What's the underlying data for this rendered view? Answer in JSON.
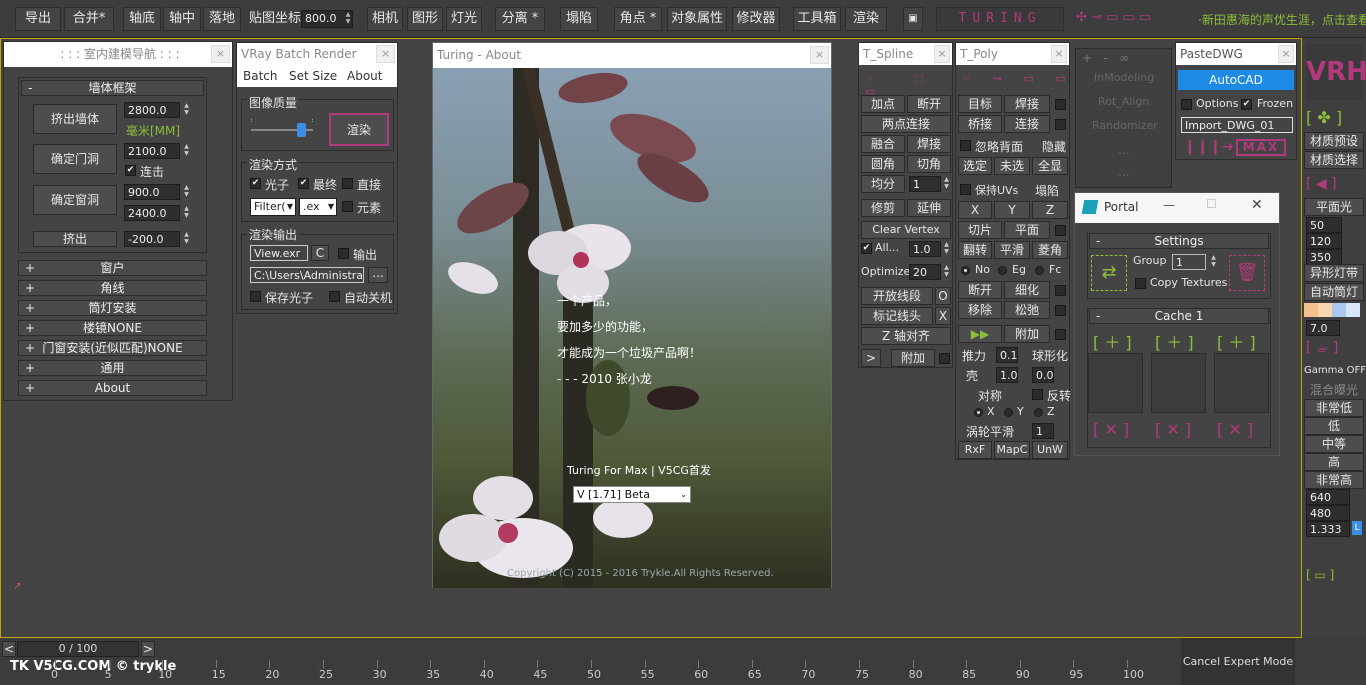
{
  "toolbar": {
    "export": "导出",
    "merge": "合并*",
    "axis_bottom": "轴底",
    "axis_center": "轴中",
    "drop": "落地",
    "map_coord_label": "贴图坐标",
    "map_coord_value": "800.0",
    "camera": "相机",
    "shape": "图形",
    "light": "灯光",
    "detach": "分离 *",
    "collapse": "塌陷",
    "corner": "角点 *",
    "obj_props": "对象属性",
    "modifier": "修改器",
    "toolbox": "工具箱",
    "render": "渲染",
    "turing_logo": "TURING",
    "news": "·新田惠海的声优生涯，点击查看"
  },
  "nav": {
    "title": ": : : 室内建模导航 : : :",
    "wall_section": "墙体框架",
    "extrude_wall": "挤出墙体",
    "wall_height": "2800.0",
    "unit": "毫米[MM]",
    "door": "确定门洞",
    "door_value": "2100.0",
    "continuous": "连击",
    "window": "确定窗洞",
    "window_value1": "900.0",
    "window_value2": "2400.0",
    "extrude": "挤出",
    "extrude_value": "-200.0",
    "rollouts": [
      "窗户",
      "角线",
      "筒灯安装",
      "楼镜NONE",
      "门窗安装(近似匹配)NONE",
      "通用",
      "About"
    ]
  },
  "vray": {
    "title": "VRay Batch Render",
    "menu": [
      "Batch",
      "Set Size",
      "About"
    ],
    "quality": "图像质量",
    "render": "渲染",
    "slider_level": 0.8,
    "method": "渲染方式",
    "photon": "光子",
    "final": "最终",
    "direct": "直接",
    "filter": "Filter(",
    "ext": ".ex",
    "element": "元素",
    "output": "渲染输出",
    "file": "View.exr",
    "c": "C",
    "output_chk": "输出",
    "path": "C:\\Users\\Administrato",
    "browse": "...",
    "save_photon": "保存光子",
    "auto_shutdown": "自动关机"
  },
  "about": {
    "title": "Turing - About",
    "lines": [
      "一个产品，",
      "要加多少的功能，",
      "才能成为一个垃圾产品啊！",
      "- - - 2010 张小龙"
    ],
    "subtitle": "Turing For Max | V5CG首发",
    "version": "V [1.71] Beta",
    "copyright": "Copyright (C) 2015 - 2016 Trykle.All Rights Reserved."
  },
  "spline": {
    "title": "T_Spline",
    "rows": [
      [
        "加点",
        "断开"
      ],
      [
        "两点连接"
      ],
      [
        "融合",
        "焊接"
      ],
      [
        "圆角",
        "切角"
      ]
    ],
    "divide": "均分",
    "divide_value": "1",
    "trim": "修剪",
    "extend": "延伸",
    "clear_vertex": "Clear Vertex",
    "all": "All...",
    "all_value": "1.0",
    "optimize": "Optimize",
    "optimize_value": "20",
    "open_seg": "开放线段",
    "o": "O",
    "mark_head": "标记线头",
    "x": "X",
    "z_align": "Z 轴对齐",
    "arrow": ">",
    "attach": "附加"
  },
  "poly": {
    "title": "T_Poly",
    "target": "目标",
    "weld": "焊接",
    "bridge": "桥接",
    "connect": "连接",
    "ignore_back": "忽略背面",
    "hide": "隐藏",
    "sel": "选定",
    "unsel": "未选",
    "all": "全显",
    "keep_uv": "保持UVs",
    "collapse": "塌陷",
    "x": "X",
    "y": "Y",
    "z": "Z",
    "slice": "切片",
    "plane": "平面",
    "flip": "翻转",
    "smooth": "平滑",
    "diamond": "菱角",
    "no": "No",
    "eg": "Eg",
    "fc": "Fc",
    "break": "断开",
    "refine": "细化",
    "move": "移除",
    "relax": "松弛",
    "attach": "附加",
    "push": "推力",
    "push_value": "0.1",
    "spherify": "球形化",
    "shell": "壳",
    "shell_v1": "1.0",
    "shell_v2": "0.0",
    "symmetry": "对称",
    "mirror": "反转",
    "turbo": "涡轮平滑",
    "turbo_value": "1",
    "rxf": "RxF",
    "mapc": "MapC",
    "unw": "UnW"
  },
  "ghost": {
    "items": [
      "InModeling",
      "Rot_Align",
      "Randomizer",
      "...",
      "..."
    ]
  },
  "pastedwg": {
    "title": "PasteDWG",
    "autocad": "AutoCAD",
    "options": "Options",
    "frozen": "Frozen",
    "layer": "Import_DWG_01",
    "max": "MAX"
  },
  "portal": {
    "title": "Portal",
    "settings": "Settings",
    "group": "Group",
    "group_value": "1",
    "copy_textures": "Copy Textures",
    "cache": "Cache 1"
  },
  "right": {
    "mat_preset": "材质预设",
    "mat_select": "材质选择",
    "plane_light": "平面光",
    "v50": "50",
    "v120": "120",
    "v350": "350",
    "ies_light": "异形灯带",
    "auto_spot": "自动筒灯",
    "v7": "7.0",
    "gamma": "Gamma OFF",
    "mixed_exposure": "混合曝光",
    "quality": [
      "非常低",
      "低",
      "中等",
      "高",
      "非常高"
    ],
    "w": "640",
    "h": "480",
    "ratio": "1.333",
    "l": "L"
  },
  "timeline": {
    "frame": "0 / 100",
    "lt": "<",
    "gt": ">",
    "ticks": [
      "0",
      "5",
      "10",
      "15",
      "20",
      "25",
      "30",
      "35",
      "40",
      "45",
      "50",
      "55",
      "60",
      "65",
      "70",
      "75",
      "80",
      "85",
      "90",
      "95",
      "100"
    ],
    "watermark": "TK V5CG.COM © trykle",
    "cancel": "Cancel Expert Mode"
  },
  "colors": {
    "accent_gold": "#c8a400",
    "turing_pink": "#b03a7c",
    "autocad_blue": "#1d8ae6",
    "portal_bg": "#f6f6f6"
  }
}
